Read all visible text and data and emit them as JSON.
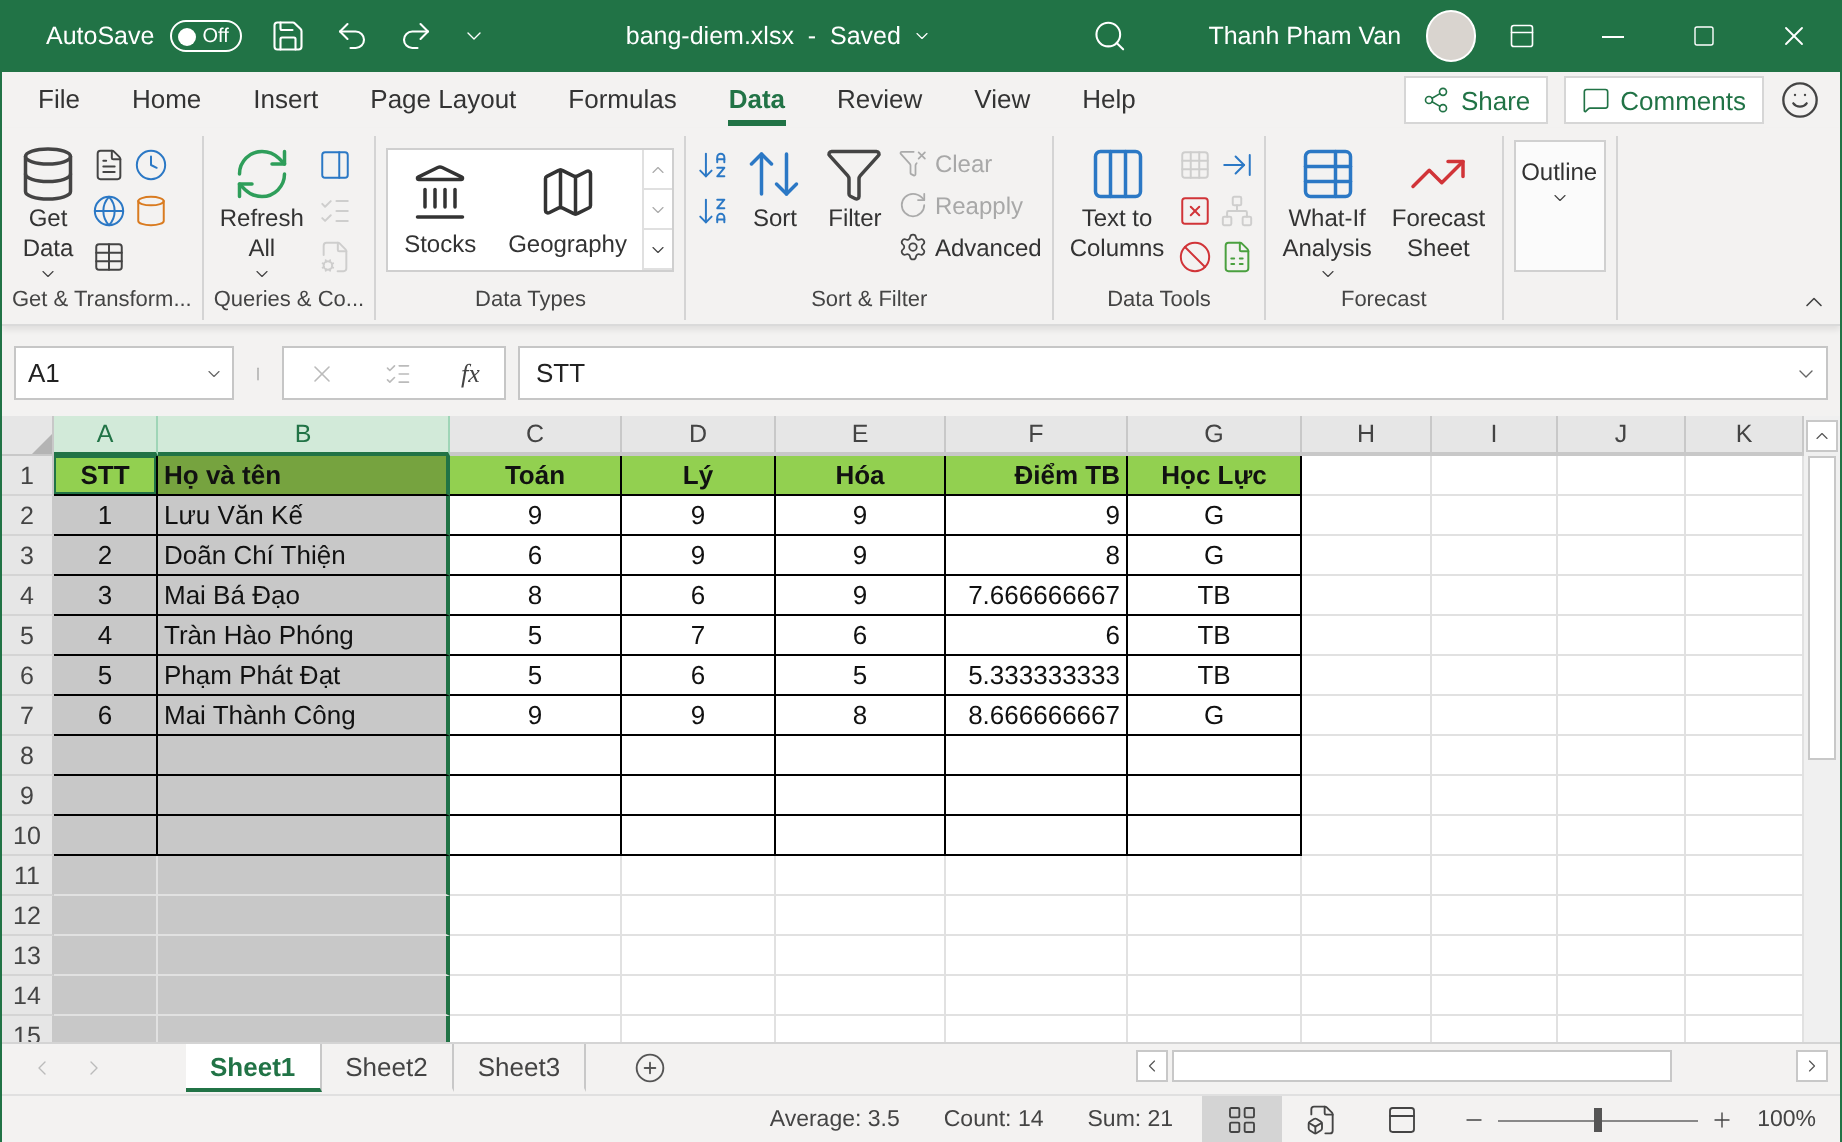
{
  "title_bar": {
    "autosave_label": "AutoSave",
    "autosave": {
      "on": false,
      "label": "Off"
    },
    "file_title": "bang-diem.xlsx  -  Saved",
    "user_name": "Thanh Pham Van"
  },
  "menu_tabs": [
    {
      "label": "File",
      "selected": false
    },
    {
      "label": "Home",
      "selected": false
    },
    {
      "label": "Insert",
      "selected": false
    },
    {
      "label": "Page Layout",
      "selected": false
    },
    {
      "label": "Formulas",
      "selected": false
    },
    {
      "label": "Data",
      "selected": true
    },
    {
      "label": "Review",
      "selected": false
    },
    {
      "label": "View",
      "selected": false
    },
    {
      "label": "Help",
      "selected": false
    }
  ],
  "share_label": "Share",
  "comments_label": "Comments",
  "ribbon_groups": [
    {
      "label": "Get & Transform...",
      "items": [
        {
          "kind": "large",
          "lines": [
            "Get",
            "Data"
          ],
          "dropdown": true
        },
        {
          "kind": "icon_column",
          "icons": [
            {
              "disabled": false
            },
            {
              "disabled": false
            },
            {
              "disabled": false
            }
          ]
        },
        {
          "kind": "icon_column",
          "icons": [
            {
              "disabled": false
            },
            {
              "disabled": false
            }
          ]
        }
      ]
    },
    {
      "label": "Queries & Co...",
      "items": [
        {
          "kind": "large",
          "lines": [
            "Refresh",
            "All"
          ],
          "dropdown": true
        },
        {
          "kind": "icon_column",
          "icons": [
            {
              "disabled": false
            },
            {
              "disabled": true
            },
            {
              "disabled": true
            }
          ]
        }
      ]
    },
    {
      "label": "Data Types",
      "items": [
        {
          "kind": "gallery",
          "entries": [
            "Stocks",
            "Geography"
          ]
        }
      ]
    },
    {
      "label": "Sort & Filter",
      "items": [
        {
          "kind": "icon_column",
          "icons": [
            {
              "disabled": false
            },
            {
              "disabled": false
            }
          ]
        },
        {
          "kind": "large",
          "lines": [
            "Sort"
          ],
          "dropdown": false
        },
        {
          "kind": "large",
          "lines": [
            "Filter"
          ],
          "dropdown": false
        },
        {
          "kind": "small_column",
          "entries": [
            {
              "label": "Clear",
              "disabled": true
            },
            {
              "label": "Reapply",
              "disabled": true
            },
            {
              "label": "Advanced",
              "disabled": false
            }
          ]
        }
      ]
    },
    {
      "label": "Data Tools",
      "items": [
        {
          "kind": "large",
          "lines": [
            "Text to",
            "Columns"
          ],
          "dropdown": false
        },
        {
          "kind": "icon_column",
          "icons": [
            {
              "disabled": true
            },
            {
              "disabled": false
            },
            {
              "disabled": false
            }
          ]
        },
        {
          "kind": "icon_column",
          "icons": [
            {
              "disabled": false
            },
            {
              "disabled": true
            },
            {
              "disabled": false
            }
          ]
        }
      ]
    },
    {
      "label": "Forecast",
      "items": [
        {
          "kind": "large",
          "lines": [
            "What-If",
            "Analysis"
          ],
          "dropdown": true
        },
        {
          "kind": "large",
          "lines": [
            "Forecast",
            "Sheet"
          ],
          "dropdown": false
        }
      ]
    },
    {
      "items": [
        {
          "kind": "outline",
          "lines": [
            "Outline"
          ],
          "dropdown": true
        }
      ]
    }
  ],
  "formula_bar": {
    "name_box": "A1",
    "function_label": "fx",
    "value": "STT"
  },
  "sheet": {
    "columns": [
      {
        "label": "A",
        "selected": true,
        "active": true
      },
      {
        "label": "B",
        "selected": true,
        "active": false
      },
      {
        "label": "C",
        "selected": false,
        "active": false
      },
      {
        "label": "D",
        "selected": false,
        "active": false
      },
      {
        "label": "E",
        "selected": false,
        "active": false
      },
      {
        "label": "F",
        "selected": false,
        "active": false
      },
      {
        "label": "G",
        "selected": false,
        "active": false
      },
      {
        "label": "H",
        "selected": false,
        "active": false
      },
      {
        "label": "I",
        "selected": false,
        "active": false
      },
      {
        "label": "J",
        "selected": false,
        "active": false
      },
      {
        "label": "K",
        "selected": false,
        "active": false
      }
    ],
    "rows": [
      {
        "label": "1",
        "kind": "header",
        "cells": [
          "STT",
          "Họ và tên",
          "Toán",
          "Lý",
          "Hóa",
          "Điểm TB",
          "Học Lực"
        ]
      },
      {
        "label": "2",
        "kind": "data",
        "cells": [
          "1",
          "Lưu Văn Kế",
          "9",
          "9",
          "9",
          "9",
          "G"
        ]
      },
      {
        "label": "3",
        "kind": "data",
        "cells": [
          "2",
          "Doãn Chí Thiện",
          "6",
          "9",
          "9",
          "8",
          "G"
        ]
      },
      {
        "label": "4",
        "kind": "data",
        "cells": [
          "3",
          "Mai Bá Đạo",
          "8",
          "6",
          "9",
          "7.666666667",
          "TB"
        ]
      },
      {
        "label": "5",
        "kind": "data",
        "cells": [
          "4",
          "Tràn Hào Phóng",
          "5",
          "7",
          "6",
          "6",
          "TB"
        ]
      },
      {
        "label": "6",
        "kind": "data",
        "cells": [
          "5",
          "Phạm Phát Đạt",
          "5",
          "6",
          "5",
          "5.333333333",
          "TB"
        ]
      },
      {
        "label": "7",
        "kind": "data",
        "cells": [
          "6",
          "Mai Thành Công",
          "9",
          "9",
          "8",
          "8.666666667",
          "G"
        ]
      },
      {
        "label": "8",
        "kind": "blank_table"
      },
      {
        "label": "9",
        "kind": "blank_table"
      },
      {
        "label": "10",
        "kind": "blank_table"
      },
      {
        "label": "11",
        "kind": "empty"
      },
      {
        "label": "12",
        "kind": "empty"
      },
      {
        "label": "13",
        "kind": "empty"
      },
      {
        "label": "14",
        "kind": "empty"
      },
      {
        "label": "15",
        "kind": "empty"
      }
    ]
  },
  "sheet_tabs": [
    {
      "label": "Sheet1",
      "selected": true
    },
    {
      "label": "Sheet2",
      "selected": false
    },
    {
      "label": "Sheet3",
      "selected": false
    }
  ],
  "status_bar": {
    "average": "Average: 3.5",
    "count": "Count: 14",
    "sum": "Sum: 21",
    "views": [
      {
        "selected": true
      },
      {
        "selected": false
      },
      {
        "selected": false
      }
    ],
    "zoom": {
      "level": 0.5,
      "label": "100%"
    }
  }
}
